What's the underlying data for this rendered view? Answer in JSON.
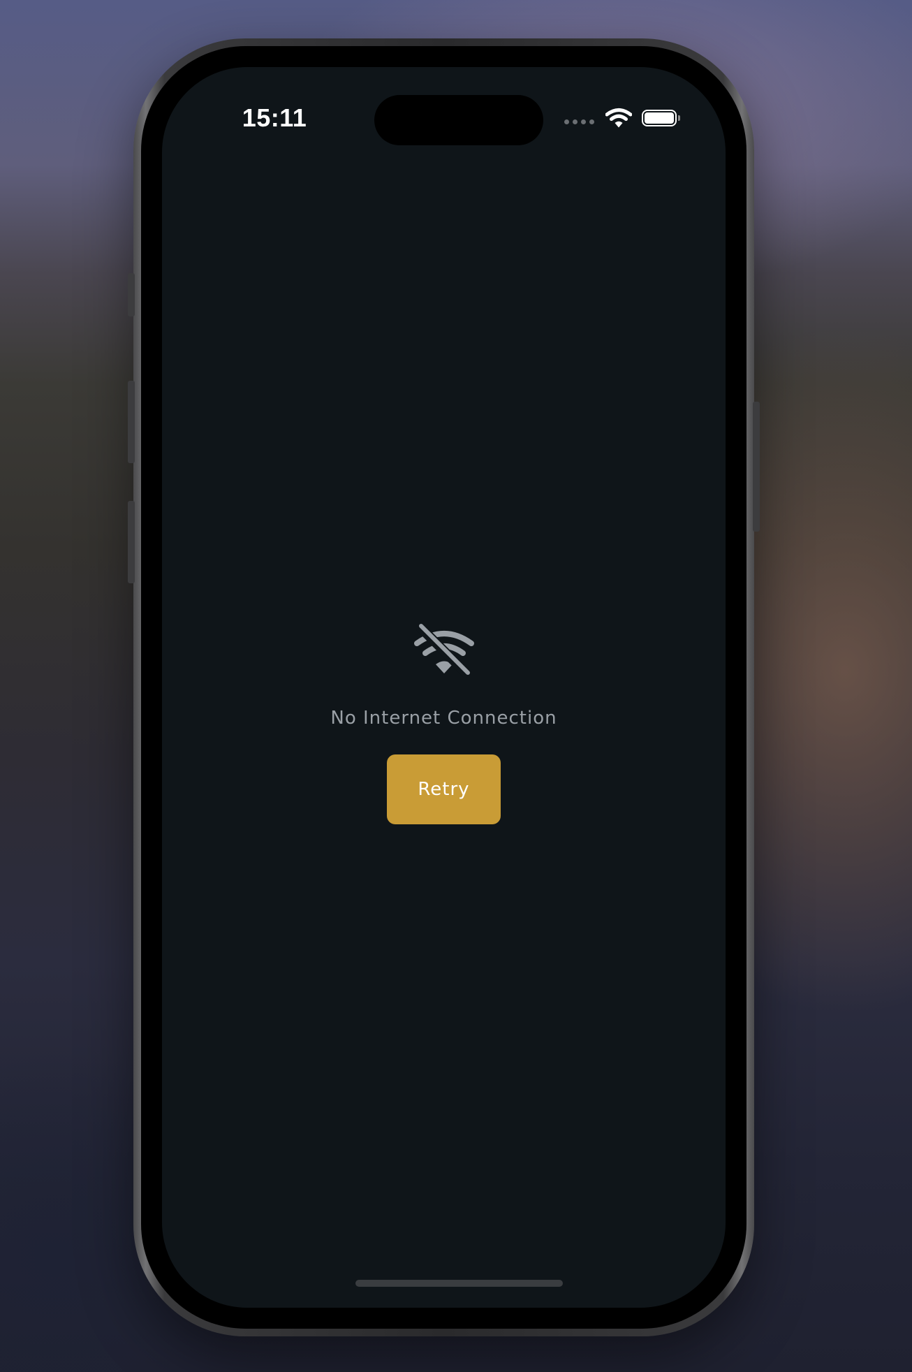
{
  "status_bar": {
    "time": "15:11",
    "icons": [
      "cellular-signal-icon",
      "wifi-icon",
      "battery-icon"
    ]
  },
  "main": {
    "icon": "wifi-off-icon",
    "message": "No Internet Connection",
    "retry_label": "Retry"
  },
  "colors": {
    "screen_background": "#0f1519",
    "accent": "#c99c36",
    "message_text": "#9aa0a6",
    "icon": "#9aa0a6"
  }
}
